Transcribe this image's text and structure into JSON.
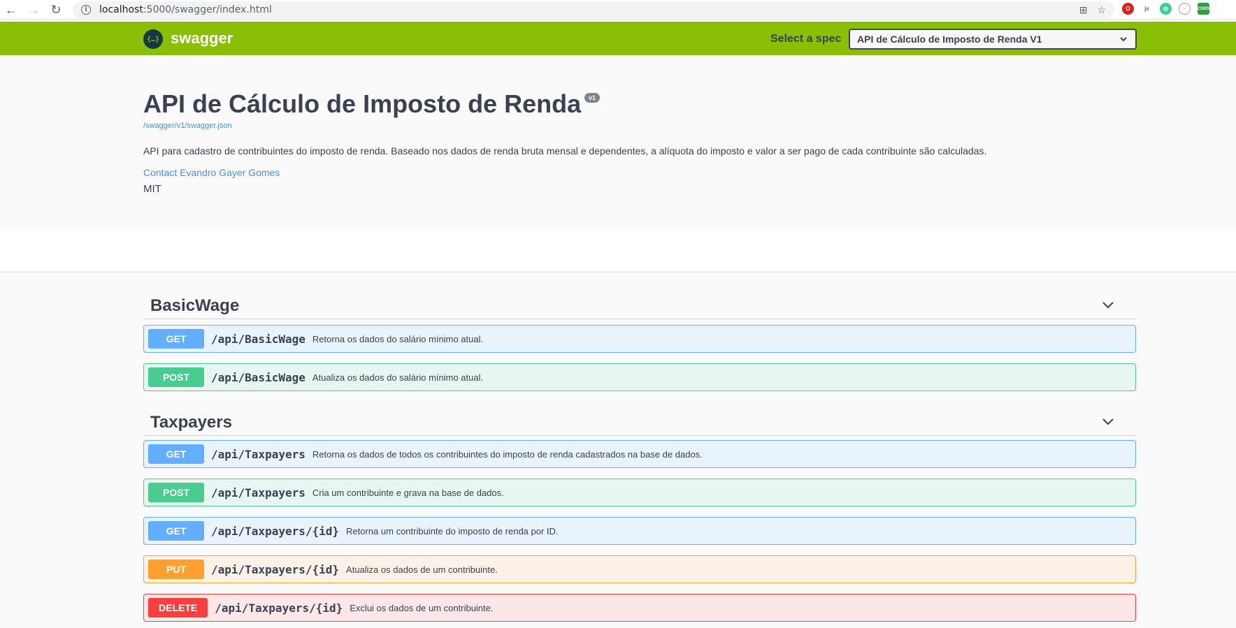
{
  "browser": {
    "url_host": "localhost",
    "url_rest": ":5000/swagger/index.html",
    "icons": [
      "back-arrow-icon",
      "forward-arrow-icon",
      "reload-icon",
      "info-icon",
      "translate-icon",
      "star-icon",
      "opera-icon",
      "js-extension-icon",
      "green-extension-icon",
      "grey-extension-icon",
      "cors-extension-icon"
    ],
    "ext_js": "js",
    "ext_cors": "CORS"
  },
  "topbar": {
    "logo_glyph": "{…}",
    "name": "swagger",
    "spec_label": "Select a spec",
    "spec_selected": "API de Cálculo de Imposto de Renda V1",
    "color": "#89bf04"
  },
  "info": {
    "title": "API de Cálculo de Imposto de Renda",
    "version": "v1",
    "json_link": "/swagger/v1/swagger.json",
    "description": "API para cadastro de contribuintes do imposto de renda. Baseado nos dados de renda bruta mensal e dependentes, a alíquota do imposto e valor a ser pago de cada contribuinte são calculadas.",
    "contact": "Contact Evandro Gayer Gomes",
    "license": "MIT"
  },
  "tags": [
    {
      "name": "BasicWage",
      "operations": [
        {
          "method": "GET",
          "path": "/api/BasicWage",
          "summary": "Retorna os dados do salário mínimo atual."
        },
        {
          "method": "POST",
          "path": "/api/BasicWage",
          "summary": "Atualiza os dados do salário mínimo atual."
        }
      ]
    },
    {
      "name": "Taxpayers",
      "operations": [
        {
          "method": "GET",
          "path": "/api/Taxpayers",
          "summary": "Retorna os dados de todos os contribuintes do imposto de renda cadastrados na base de dados."
        },
        {
          "method": "POST",
          "path": "/api/Taxpayers",
          "summary": "Cria um contribuinte e grava na base de dados."
        },
        {
          "method": "GET",
          "path": "/api/Taxpayers/{id}",
          "summary": "Retorna um contribuinte do imposto de renda por ID."
        },
        {
          "method": "PUT",
          "path": "/api/Taxpayers/{id}",
          "summary": "Atualiza os dados de um contribuinte."
        },
        {
          "method": "DELETE",
          "path": "/api/Taxpayers/{id}",
          "summary": "Exclui os dados de um contribuinte."
        }
      ]
    }
  ],
  "method_colors": {
    "GET": "#61affe",
    "POST": "#49cc90",
    "PUT": "#fca130",
    "DELETE": "#f93e3e"
  }
}
